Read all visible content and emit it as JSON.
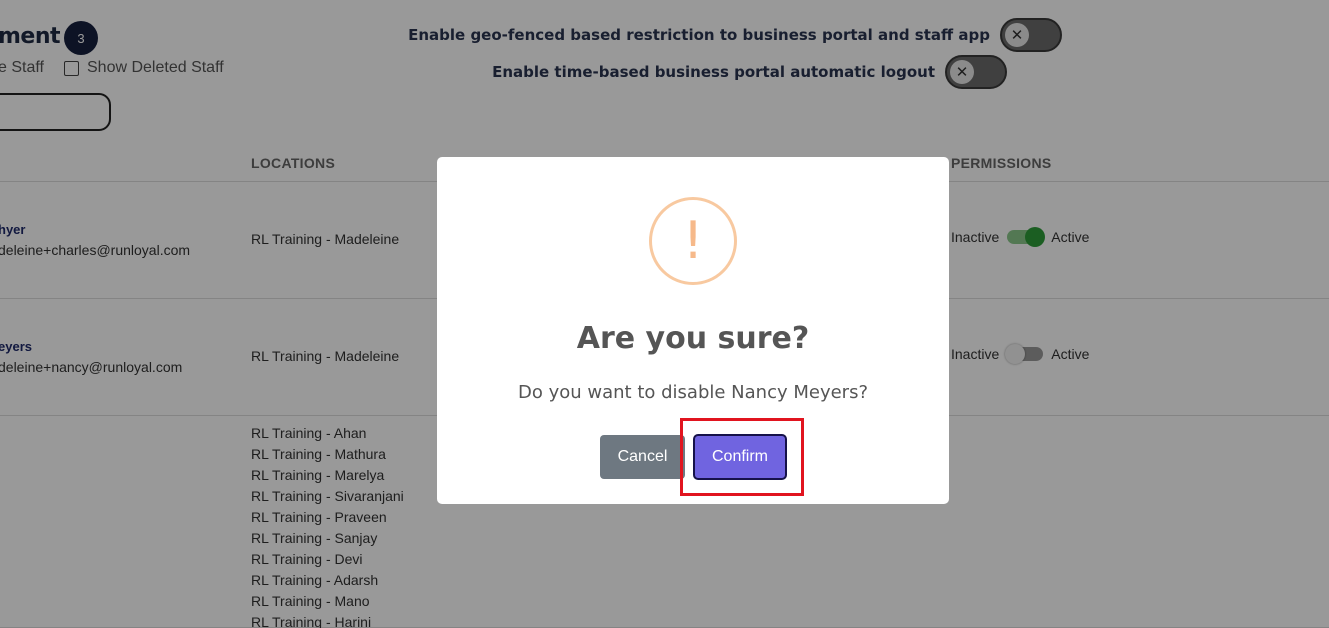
{
  "header": {
    "title": "ment",
    "staff_count": "3",
    "staff_filter_label": "e Staff",
    "show_deleted_label": "Show Deleted Staff",
    "geo_fence_label": "Enable geo-fenced based restriction to business portal and staff app",
    "auto_logout_label": "Enable time-based business portal automatic logout",
    "toggle_off_glyph": "✕"
  },
  "table": {
    "columns": {
      "locations": "LOCATIONS",
      "permissions": "PERMISSIONS"
    },
    "rows": [
      {
        "name": "hyer",
        "email": "deleine+charles@runloyal.com",
        "location": "RL Training - Madeleine",
        "inactive_label": "Inactive",
        "active_label": "Active",
        "active": true
      },
      {
        "name": "eyers",
        "email": "deleine+nancy@runloyal.com",
        "location": "RL Training - Madeleine",
        "inactive_label": "Inactive",
        "active_label": "Active",
        "active": false
      }
    ],
    "row3_locations": [
      "RL Training - Ahan",
      "RL Training - Mathura",
      "RL Training - Marelya",
      "RL Training - Sivaranjani",
      "RL Training - Praveen",
      "RL Training - Sanjay",
      "RL Training - Devi",
      "RL Training - Adarsh",
      "RL Training - Mano",
      "RL Training - Harini"
    ]
  },
  "modal": {
    "icon_glyph": "!",
    "title": "Are you sure?",
    "message": "Do you want to disable Nancy Meyers?",
    "cancel_label": "Cancel",
    "confirm_label": "Confirm"
  },
  "colors": {
    "confirm": "#7064e0",
    "cancel": "#6e7881",
    "warning": "#f8c9a0",
    "highlight": "#e1141f"
  }
}
